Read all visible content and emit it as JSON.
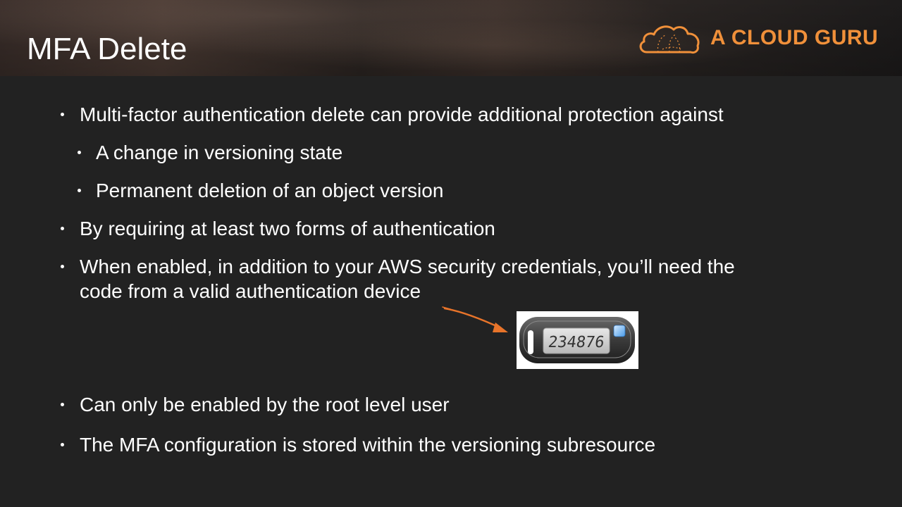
{
  "slide": {
    "title": "MFA Delete",
    "logo": {
      "text": "A CLOUD GURU",
      "icon": "cloud-logo-icon",
      "color": "#f0903a"
    },
    "bullets": [
      {
        "level": 1,
        "text": "Multi-factor authentication delete can provide additional protection against"
      },
      {
        "level": 2,
        "text": "A change in versioning state"
      },
      {
        "level": 2,
        "text": "Permanent deletion of an object version"
      },
      {
        "level": 1,
        "text": "By requiring at least two forms of authentication"
      },
      {
        "level": 1,
        "text": "When enabled, in addition to your AWS security credentials, you’ll need the"
      },
      {
        "level": 1,
        "text": "code from a valid authentication device",
        "continuation": true
      },
      {
        "level": 1,
        "text": "Can only be enabled by the root level user"
      },
      {
        "level": 1,
        "text": "The MFA configuration is stored within the versioning subresource"
      }
    ],
    "device": {
      "icon": "mfa-token-device-icon",
      "display_code": "234876"
    },
    "arrow": {
      "icon": "arrow-icon",
      "color": "#e8742a"
    },
    "colors": {
      "background": "#222222",
      "text": "#ffffff"
    }
  }
}
